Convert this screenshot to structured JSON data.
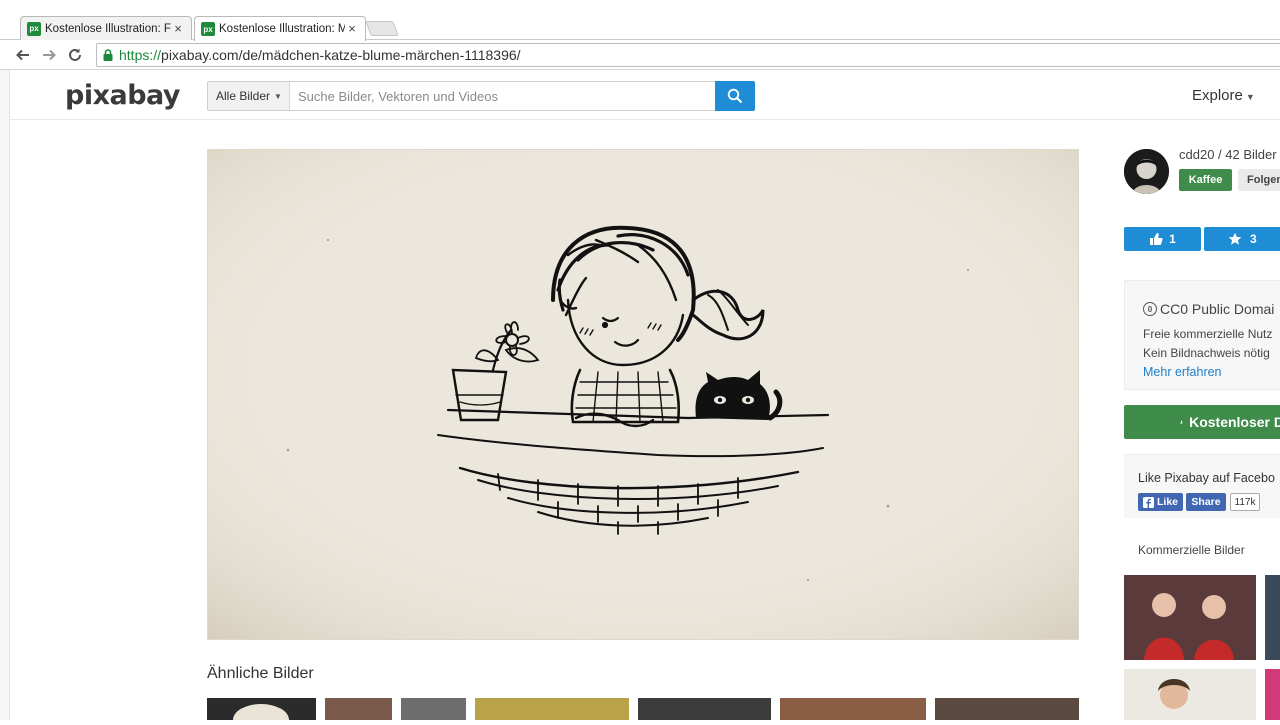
{
  "browser": {
    "tabs": [
      {
        "title": "Kostenlose Illustration: Fra",
        "active": false
      },
      {
        "title": "Kostenlose Illustration: Mä",
        "active": true
      }
    ],
    "favicon_text": "px",
    "close_glyph": "×",
    "url_scheme": "https://",
    "url_rest": "pixabay.com/de/mädchen-katze-blume-märchen-1118396/"
  },
  "header": {
    "logo": "pixabay",
    "search_type": "Alle Bilder",
    "search_placeholder": "Suche Bilder, Vektoren und Videos",
    "explore": "Explore"
  },
  "main": {
    "similar_title": "Ähnliche Bilder"
  },
  "sidebar": {
    "user_meta": "cdd20 / 42 Bilder",
    "kaffee": "Kaffee",
    "folgen": "Folgen",
    "like_count": "1",
    "fav_count": "3",
    "license_title": "CC0 Public Domai",
    "cc_symbol": "0",
    "license_line1": "Freie kommerzielle Nutz",
    "license_line2": "Kein Bildnachweis nötig",
    "license_link": "Mehr erfahren",
    "download": "Kostenloser D",
    "fb_title": "Like Pixabay auf Facebo",
    "fb_like": "Like",
    "fb_share": "Share",
    "fb_count": "117k",
    "commercial_title": "Kommerzielle Bilder"
  },
  "colors": {
    "accent_blue": "#1f8dd6",
    "accent_green": "#3f8c4a",
    "facebook": "#4267b2",
    "paper": "#ebe7dc"
  }
}
